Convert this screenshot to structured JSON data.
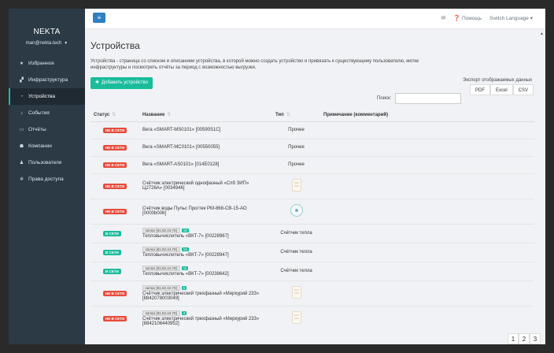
{
  "sidebar": {
    "brand": "NEKTA",
    "user": "man@nekta.tech",
    "items": [
      {
        "label": "Избранное",
        "icon": "star-icon"
      },
      {
        "label": "Инфраструктура",
        "icon": "sitemap-icon"
      },
      {
        "label": "Устройства",
        "icon": "dashboard-icon"
      },
      {
        "label": "События",
        "icon": "bell-icon"
      },
      {
        "label": "Отчёты",
        "icon": "folder-icon"
      },
      {
        "label": "Компании",
        "icon": "users-icon"
      },
      {
        "label": "Пользователи",
        "icon": "user-icon"
      },
      {
        "label": "Права доступа",
        "icon": "gear-icon"
      }
    ]
  },
  "topbar": {
    "help": "Помощь",
    "language": "Switch Language"
  },
  "page": {
    "title": "Устройства",
    "description": "Устройства - страница со списком и описанием устройства, в которой можно создать устройство и привязать к существующему пользователю, метке инфраструктуры и посмотреть отчёты за период с возможностью выгрузки.",
    "add_button": "Добавить устройство",
    "export_label": "Экспорт отображаемых данных",
    "export_pdf": "PDF",
    "export_excel": "Excel",
    "export_csv": "CSV",
    "search_label": "Поиск:"
  },
  "table": {
    "headers": {
      "status": "Статус",
      "name": "Название",
      "type": "Тип",
      "note": "Примечание (комментарий)"
    },
    "rows": [
      {
        "status": "НЕ В СЕТИ",
        "online": false,
        "gateway": "",
        "count": "",
        "name": "Вега «SMART-MS0101» [00590S1C]",
        "name2": "",
        "type": "Прочее",
        "icon": ""
      },
      {
        "status": "НЕ В СЕТИ",
        "online": false,
        "gateway": "",
        "count": "",
        "name": "Вега «SMART-MC0101» [00550055]",
        "name2": "",
        "type": "Прочее",
        "icon": ""
      },
      {
        "status": "НЕ В СЕТИ",
        "online": false,
        "gateway": "",
        "count": "",
        "name": "Вега «SMART-AS0101» [014E0128]",
        "name2": "",
        "type": "Прочее",
        "icon": ""
      },
      {
        "status": "НЕ В СЕТИ",
        "online": false,
        "gateway": "",
        "count": "",
        "name": "Счётчик электрический однофазный «Спб ЗИП»",
        "name2": "Ц2726А» [0034946]",
        "type": "",
        "icon": "electric-meter-icon"
      },
      {
        "status": "НЕ В СЕТИ",
        "online": false,
        "gateway": "",
        "count": "",
        "name": "Счётчик воды Пульс Прогтек РМ-868-СВ-15-АО [0000b006]",
        "name2": "",
        "type": "",
        "icon": "water-meter-icon"
      },
      {
        "status": "В СЕТИ",
        "online": true,
        "gateway": "Шлюз [81.82.44.79]",
        "count": "15",
        "name": "Тепловычислитель «ВКТ-7» [00228967]",
        "name2": "",
        "type": "Счётчик тепла",
        "icon": ""
      },
      {
        "status": "В СЕТИ",
        "online": true,
        "gateway": "Шлюз [81.82.44.79]",
        "count": "13",
        "name": "Тепловычислитель «ВКТ-7» [00228947]",
        "name2": "",
        "type": "Счётчик тепла",
        "icon": ""
      },
      {
        "status": "В СЕТИ",
        "online": true,
        "gateway": "Шлюз [81.82.44.79]",
        "count": "11",
        "name": "Тепловычислитель «ВКТ-7» [00238642]",
        "name2": "",
        "type": "Счётчик тепла",
        "icon": ""
      },
      {
        "status": "НЕ В СЕТИ",
        "online": false,
        "gateway": "Шлюз [81.82.44.79]",
        "count": "5",
        "name": "Счётчик электрический трехфазный «Меркурий 233»",
        "name2": "[8842078003049]",
        "type": "",
        "icon": "electric-meter-icon"
      },
      {
        "status": "НЕ В СЕТИ",
        "online": false,
        "gateway": "Шлюз [81.82.44.79]",
        "count": "4",
        "name": "Счётчик электрический трехфазный «Меркурий 233»",
        "name2": "[8842106440952]",
        "type": "",
        "icon": "electric-meter-icon"
      }
    ]
  },
  "pager": [
    "1",
    "2",
    "3"
  ],
  "colors": {
    "sidebar": "#2b3a45",
    "accent": "#1abc9c",
    "offline": "#e74c3c",
    "primary": "#2f7fc1"
  }
}
